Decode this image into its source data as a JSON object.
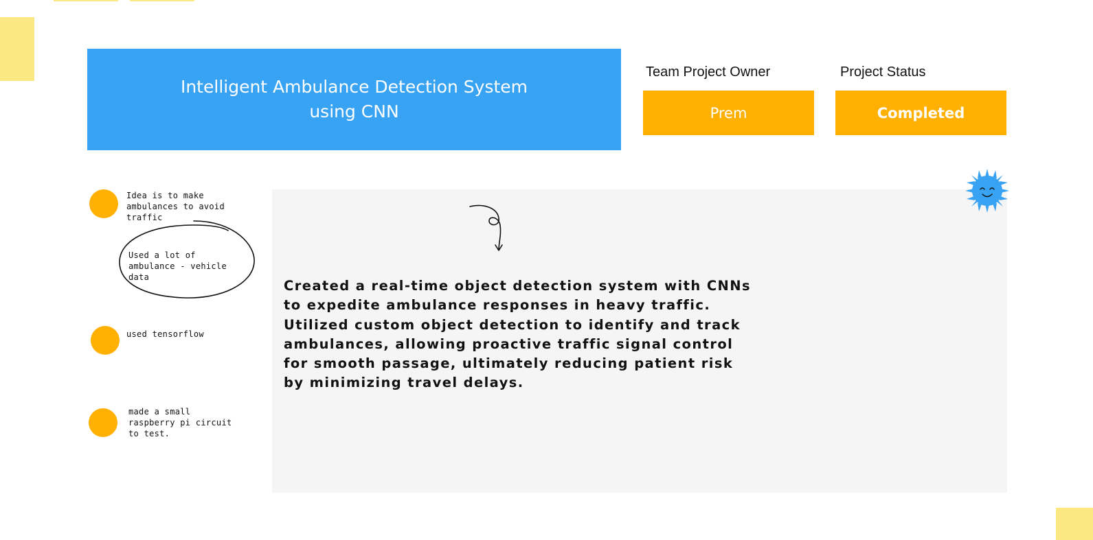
{
  "header": {
    "title": "Intelligent Ambulance Detection System using CNN",
    "owner_label": "Team Project Owner",
    "owner_value": "Prem",
    "status_label": "Project Status",
    "status_value": "Completed"
  },
  "notes": [
    {
      "text": "Idea is to make ambulances to avoid traffic"
    },
    {
      "text": "Used a lot of ambulance - vehicle data"
    },
    {
      "text": "used tensorflow"
    },
    {
      "text": "made a small raspberry pi circuit to test."
    }
  ],
  "main": {
    "description": "Created a real-time object detection system with CNNs to expedite ambulance responses in heavy traffic. Utilized custom object detection to identify and track ambulances, allowing proactive traffic signal control for smooth passage, ultimately reducing patient risk by minimizing travel delays."
  },
  "decorations": {
    "sun_icon": "smiling-sun-sticker",
    "squiggle_icon": "curly-arrow",
    "accent_blue": "#38a2f3",
    "accent_orange": "#ffb000",
    "sticky_yellow": "#fbe883"
  }
}
